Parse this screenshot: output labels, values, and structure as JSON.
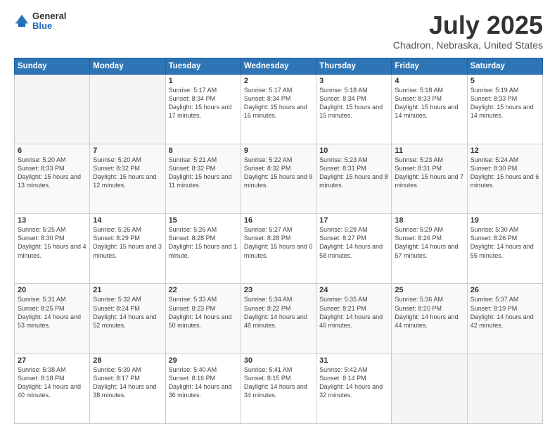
{
  "logo": {
    "general": "General",
    "blue": "Blue"
  },
  "header": {
    "month": "July 2025",
    "location": "Chadron, Nebraska, United States"
  },
  "days_header": [
    "Sunday",
    "Monday",
    "Tuesday",
    "Wednesday",
    "Thursday",
    "Friday",
    "Saturday"
  ],
  "weeks": [
    [
      {
        "num": "",
        "info": ""
      },
      {
        "num": "",
        "info": ""
      },
      {
        "num": "1",
        "info": "Sunrise: 5:17 AM\nSunset: 8:34 PM\nDaylight: 15 hours and 17 minutes."
      },
      {
        "num": "2",
        "info": "Sunrise: 5:17 AM\nSunset: 8:34 PM\nDaylight: 15 hours and 16 minutes."
      },
      {
        "num": "3",
        "info": "Sunrise: 5:18 AM\nSunset: 8:34 PM\nDaylight: 15 hours and 15 minutes."
      },
      {
        "num": "4",
        "info": "Sunrise: 5:18 AM\nSunset: 8:33 PM\nDaylight: 15 hours and 14 minutes."
      },
      {
        "num": "5",
        "info": "Sunrise: 5:19 AM\nSunset: 8:33 PM\nDaylight: 15 hours and 14 minutes."
      }
    ],
    [
      {
        "num": "6",
        "info": "Sunrise: 5:20 AM\nSunset: 8:33 PM\nDaylight: 15 hours and 13 minutes."
      },
      {
        "num": "7",
        "info": "Sunrise: 5:20 AM\nSunset: 8:32 PM\nDaylight: 15 hours and 12 minutes."
      },
      {
        "num": "8",
        "info": "Sunrise: 5:21 AM\nSunset: 8:32 PM\nDaylight: 15 hours and 11 minutes."
      },
      {
        "num": "9",
        "info": "Sunrise: 5:22 AM\nSunset: 8:32 PM\nDaylight: 15 hours and 9 minutes."
      },
      {
        "num": "10",
        "info": "Sunrise: 5:23 AM\nSunset: 8:31 PM\nDaylight: 15 hours and 8 minutes."
      },
      {
        "num": "11",
        "info": "Sunrise: 5:23 AM\nSunset: 8:31 PM\nDaylight: 15 hours and 7 minutes."
      },
      {
        "num": "12",
        "info": "Sunrise: 5:24 AM\nSunset: 8:30 PM\nDaylight: 15 hours and 6 minutes."
      }
    ],
    [
      {
        "num": "13",
        "info": "Sunrise: 5:25 AM\nSunset: 8:30 PM\nDaylight: 15 hours and 4 minutes."
      },
      {
        "num": "14",
        "info": "Sunrise: 5:26 AM\nSunset: 8:29 PM\nDaylight: 15 hours and 3 minutes."
      },
      {
        "num": "15",
        "info": "Sunrise: 5:26 AM\nSunset: 8:28 PM\nDaylight: 15 hours and 1 minute."
      },
      {
        "num": "16",
        "info": "Sunrise: 5:27 AM\nSunset: 8:28 PM\nDaylight: 15 hours and 0 minutes."
      },
      {
        "num": "17",
        "info": "Sunrise: 5:28 AM\nSunset: 8:27 PM\nDaylight: 14 hours and 58 minutes."
      },
      {
        "num": "18",
        "info": "Sunrise: 5:29 AM\nSunset: 8:26 PM\nDaylight: 14 hours and 57 minutes."
      },
      {
        "num": "19",
        "info": "Sunrise: 5:30 AM\nSunset: 8:26 PM\nDaylight: 14 hours and 55 minutes."
      }
    ],
    [
      {
        "num": "20",
        "info": "Sunrise: 5:31 AM\nSunset: 8:25 PM\nDaylight: 14 hours and 53 minutes."
      },
      {
        "num": "21",
        "info": "Sunrise: 5:32 AM\nSunset: 8:24 PM\nDaylight: 14 hours and 52 minutes."
      },
      {
        "num": "22",
        "info": "Sunrise: 5:33 AM\nSunset: 8:23 PM\nDaylight: 14 hours and 50 minutes."
      },
      {
        "num": "23",
        "info": "Sunrise: 5:34 AM\nSunset: 8:22 PM\nDaylight: 14 hours and 48 minutes."
      },
      {
        "num": "24",
        "info": "Sunrise: 5:35 AM\nSunset: 8:21 PM\nDaylight: 14 hours and 46 minutes."
      },
      {
        "num": "25",
        "info": "Sunrise: 5:36 AM\nSunset: 8:20 PM\nDaylight: 14 hours and 44 minutes."
      },
      {
        "num": "26",
        "info": "Sunrise: 5:37 AM\nSunset: 8:19 PM\nDaylight: 14 hours and 42 minutes."
      }
    ],
    [
      {
        "num": "27",
        "info": "Sunrise: 5:38 AM\nSunset: 8:18 PM\nDaylight: 14 hours and 40 minutes."
      },
      {
        "num": "28",
        "info": "Sunrise: 5:39 AM\nSunset: 8:17 PM\nDaylight: 14 hours and 38 minutes."
      },
      {
        "num": "29",
        "info": "Sunrise: 5:40 AM\nSunset: 8:16 PM\nDaylight: 14 hours and 36 minutes."
      },
      {
        "num": "30",
        "info": "Sunrise: 5:41 AM\nSunset: 8:15 PM\nDaylight: 14 hours and 34 minutes."
      },
      {
        "num": "31",
        "info": "Sunrise: 5:42 AM\nSunset: 8:14 PM\nDaylight: 14 hours and 32 minutes."
      },
      {
        "num": "",
        "info": ""
      },
      {
        "num": "",
        "info": ""
      }
    ]
  ]
}
